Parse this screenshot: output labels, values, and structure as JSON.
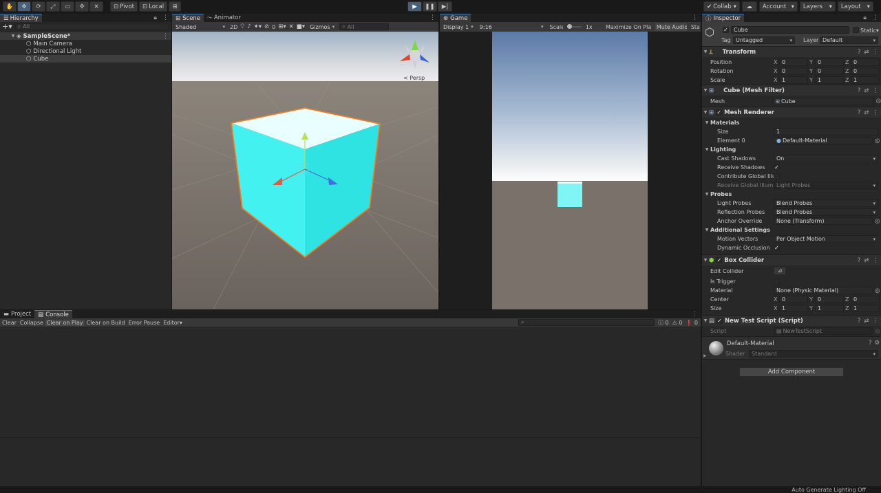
{
  "toolbar": {
    "pivot": "Pivot",
    "local": "Local",
    "collab": "Collab",
    "account": "Account",
    "layers": "Layers",
    "layout": "Layout"
  },
  "hierarchy": {
    "tab": "Hierarchy",
    "search_placeholder": "All",
    "scene": "SampleScene*",
    "items": [
      "Main Camera",
      "Directional Light",
      "Cube"
    ]
  },
  "scene_view": {
    "tabs": [
      "Scene",
      "Animator"
    ],
    "shading": "Shaded",
    "mode_2d": "2D",
    "fx_count": "0",
    "gizmos": "Gizmos",
    "search_placeholder": "All",
    "persp": "< Persp"
  },
  "game_view": {
    "tab": "Game",
    "display": "Display 1",
    "aspect": "9:16",
    "scale_label": "Scale",
    "scale_value": "1x",
    "maximize": "Maximize On Play",
    "mute": "Mute Audio",
    "stats": "Sta"
  },
  "bottom": {
    "tabs": [
      "Project",
      "Console"
    ],
    "buttons": [
      "Clear",
      "Collapse",
      "Clear on Play",
      "Clear on Build",
      "Error Pause",
      "Editor"
    ],
    "info_count": "0",
    "warn_count": "0",
    "error_count": "0"
  },
  "status": {
    "text": "Auto Generate Lighting Off"
  },
  "inspector": {
    "tab": "Inspector",
    "object_name": "Cube",
    "static_label": "Static",
    "tag_label": "Tag",
    "tag": "Untagged",
    "layer_label": "Layer",
    "layer": "Default",
    "transform": {
      "title": "Transform",
      "rows": [
        {
          "label": "Position",
          "x": "0",
          "y": "0",
          "z": "0"
        },
        {
          "label": "Rotation",
          "x": "0",
          "y": "0",
          "z": "0"
        },
        {
          "label": "Scale",
          "x": "1",
          "y": "1",
          "z": "1"
        }
      ]
    },
    "mesh_filter": {
      "title": "Cube (Mesh Filter)",
      "mesh_label": "Mesh",
      "mesh": "Cube"
    },
    "mesh_renderer": {
      "title": "Mesh Renderer",
      "materials": "Materials",
      "size_label": "Size",
      "size": "1",
      "element0_label": "Element 0",
      "element0": "Default-Material",
      "lighting": "Lighting",
      "cast_shadows_label": "Cast Shadows",
      "cast_shadows": "On",
      "receive_shadows_label": "Receive Shadows",
      "contribute_gi_label": "Contribute Global Illu",
      "receive_gi_label": "Receive Global Illumi",
      "receive_gi": "Light Probes",
      "probes": "Probes",
      "light_probes_label": "Light Probes",
      "light_probes": "Blend Probes",
      "reflection_probes_label": "Reflection Probes",
      "reflection_probes": "Blend Probes",
      "anchor_override_label": "Anchor Override",
      "anchor_override": "None (Transform)",
      "additional": "Additional Settings",
      "motion_vectors_label": "Motion Vectors",
      "motion_vectors": "Per Object Motion",
      "dynamic_occlusion_label": "Dynamic Occlusion"
    },
    "box_collider": {
      "title": "Box Collider",
      "edit_collider_label": "Edit Collider",
      "is_trigger_label": "Is Trigger",
      "material_label": "Material",
      "material": "None (Physic Material)",
      "center_label": "Center",
      "center": {
        "x": "0",
        "y": "0",
        "z": "0"
      },
      "size_label": "Size",
      "size": {
        "x": "1",
        "y": "1",
        "z": "1"
      }
    },
    "script": {
      "title": "New Test Script (Script)",
      "script_label": "Script",
      "script": "NewTestScript"
    },
    "material": {
      "name": "Default-Material",
      "shader_label": "Shader",
      "shader": "Standard"
    },
    "add_component": "Add Component"
  }
}
